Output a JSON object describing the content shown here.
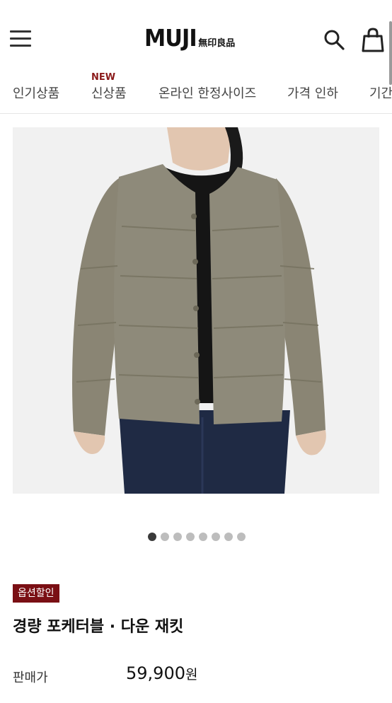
{
  "header": {
    "logo_main": "MUJI",
    "logo_sub": "無印良品",
    "menu_icon": "hamburger-menu-icon",
    "search_icon": "search-icon",
    "cart_icon": "shopping-bag-icon"
  },
  "nav": {
    "items": [
      {
        "label": "인기상품"
      },
      {
        "label": "신상품",
        "badge": "NEW"
      },
      {
        "label": "온라인 한정사이즈"
      },
      {
        "label": "가격 인하"
      },
      {
        "label": "기간"
      }
    ]
  },
  "carousel": {
    "total": 8,
    "active": 1
  },
  "product": {
    "badge": "옵션할인",
    "title": "경량 포케터블 · 다운 재킷",
    "price_label": "판매가",
    "price_value": "59,900",
    "price_unit": "원"
  },
  "colors": {
    "brand": "#7a0f14",
    "jacket": "#8e8a7a",
    "badge_new": "#8b1a1a"
  }
}
